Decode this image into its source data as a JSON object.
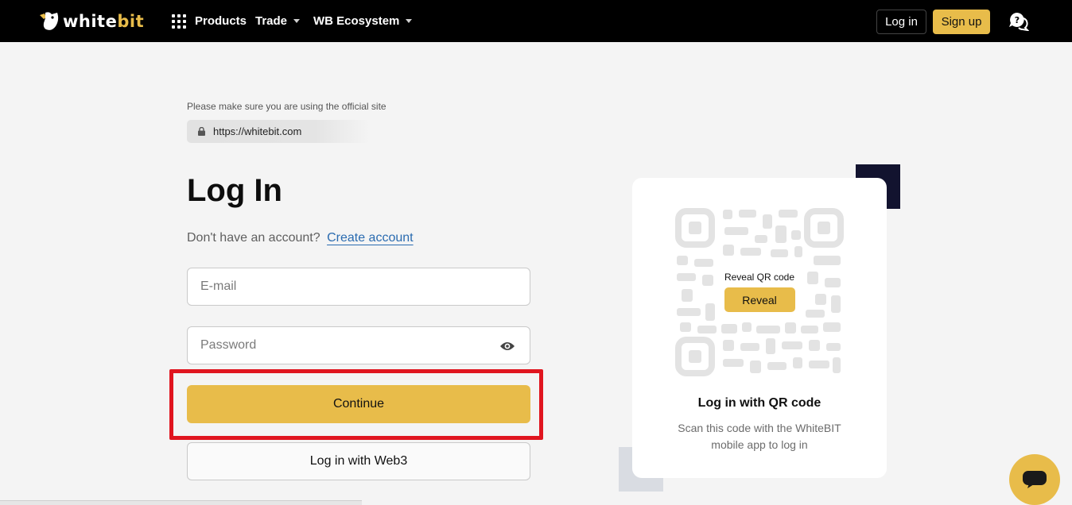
{
  "header": {
    "logo_white": "white",
    "logo_accent": "bit",
    "nav": {
      "products": "Products",
      "trade": "Trade",
      "ecosystem": "WB Ecosystem"
    },
    "login_label": "Log in",
    "signup_label": "Sign up"
  },
  "official": {
    "note": "Please make sure you are using the official site",
    "url": "https://whitebit.com"
  },
  "login": {
    "title": "Log In",
    "no_account": "Don't have an account?",
    "create_account": "Create account",
    "email_placeholder": "E-mail",
    "password_placeholder": "Password",
    "continue_label": "Continue",
    "web3_label": "Log in with Web3"
  },
  "qr": {
    "reveal_label": "Reveal QR code",
    "reveal_button": "Reveal",
    "title": "Log in with QR code",
    "description": "Scan this code with the WhiteBIT mobile app to log in"
  },
  "icons": {
    "apps": "grid-apps-icon",
    "support": "support-chat-icon",
    "lock": "lock-icon",
    "eye": "eye-icon",
    "chat": "chat-bubble-icon"
  },
  "colors": {
    "accent": "#e8bc4a",
    "header_bg": "#000000",
    "page_bg": "#f4f4f4",
    "link": "#2a6bb0",
    "highlight": "#e0151f"
  }
}
